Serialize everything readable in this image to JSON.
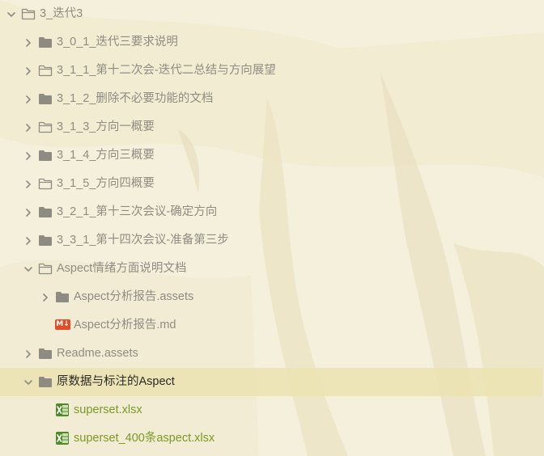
{
  "colors": {
    "background": "#f5f0dc",
    "label": "#8f8c82",
    "selected_label": "#2c2a22",
    "selected_row": "#ebe3b2",
    "excel_green": "#7c9a22",
    "folder_grey": "#8e8b82",
    "markdown_orange": "#e34c26"
  },
  "tree": {
    "items": [
      {
        "label": "3_迭代3",
        "depth": 0,
        "expanded": true,
        "folder_style": "outline"
      },
      {
        "label": "3_0_1_迭代三要求说明",
        "depth": 1,
        "expanded": false,
        "folder_style": "filled"
      },
      {
        "label": "3_1_1_第十二次会-迭代二总结与方向展望",
        "depth": 1,
        "expanded": false,
        "folder_style": "outline"
      },
      {
        "label": "3_1_2_删除不必要功能的文档",
        "depth": 1,
        "expanded": false,
        "folder_style": "filled"
      },
      {
        "label": "3_1_3_方向一概要",
        "depth": 1,
        "expanded": false,
        "folder_style": "outline"
      },
      {
        "label": "3_1_4_方向三概要",
        "depth": 1,
        "expanded": false,
        "folder_style": "filled"
      },
      {
        "label": "3_1_5_方向四概要",
        "depth": 1,
        "expanded": false,
        "folder_style": "outline"
      },
      {
        "label": "3_2_1_第十三次会议-确定方向",
        "depth": 1,
        "expanded": false,
        "folder_style": "filled"
      },
      {
        "label": "3_3_1_第十四次会议-准备第三步",
        "depth": 1,
        "expanded": false,
        "folder_style": "filled"
      },
      {
        "label": "Aspect情绪方面说明文档",
        "depth": 1,
        "expanded": true,
        "folder_style": "outline"
      },
      {
        "label": "Aspect分析报告.assets",
        "depth": 2,
        "expanded": false,
        "folder_style": "filled"
      },
      {
        "label": "Aspect分析报告.md",
        "depth": 2,
        "type": "markdown-file",
        "badge": "M↓"
      },
      {
        "label": "Readme.assets",
        "depth": 1,
        "expanded": false,
        "folder_style": "filled"
      },
      {
        "label": "原数据与标注的Aspect",
        "depth": 1,
        "expanded": true,
        "folder_style": "filled",
        "selected": true
      },
      {
        "label": "superset.xlsx",
        "depth": 2,
        "type": "excel-file"
      },
      {
        "label": "superset_400条aspect.xlsx",
        "depth": 2,
        "type": "excel-file"
      }
    ]
  }
}
